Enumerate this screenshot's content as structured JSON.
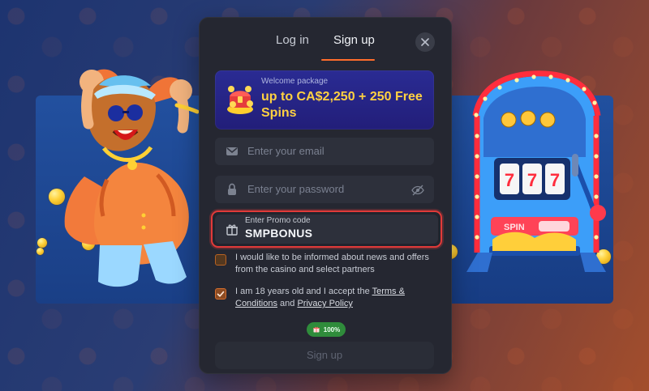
{
  "tabs": {
    "login": "Log in",
    "signup": "Sign up"
  },
  "welcome": {
    "title": "Welcome package",
    "offer": "up to CA$2,250 + 250 Free Spins"
  },
  "fields": {
    "email_placeholder": "Enter your email",
    "password_placeholder": "Enter your password",
    "promo_label": "Enter Promo code",
    "promo_value": "SMPBONUS"
  },
  "consents": {
    "news": "I would like to be informed about news and offers from the casino and select partners",
    "age_prefix": "I am 18 years old and I accept the",
    "terms_link": "Terms & Conditions",
    "and": "and",
    "privacy_link": "Privacy Policy"
  },
  "progress_badge": "100%",
  "buttons": {
    "signup": "Sign up"
  },
  "slot_label": "SPIN",
  "slot_digits": [
    "7",
    "7",
    "7"
  ],
  "icons": {
    "close": "close-icon",
    "mail": "mail-icon",
    "lock": "lock-icon",
    "eye_off": "eye-off-icon",
    "gift": "gift-icon",
    "checkbox_checked": "check-icon"
  },
  "colors": {
    "accent": "#ff6d2c",
    "offer_text": "#ffd141",
    "modal_background": "#252731",
    "error_border": "#e23a39",
    "success_badge": "#2f8c3b"
  }
}
